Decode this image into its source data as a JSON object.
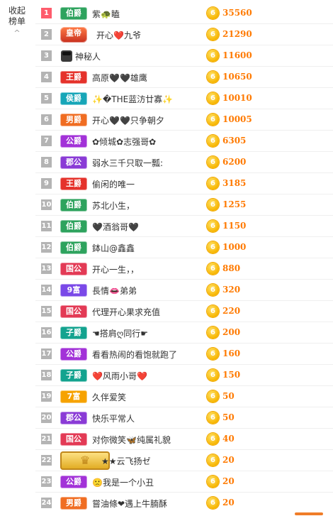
{
  "sidebar": {
    "collapse_label_1": "收起",
    "collapse_label_2": "榜单",
    "chevron": "^"
  },
  "colors": {
    "rank_top": "#fe5c6c",
    "rank_default": "#b4b4b4",
    "score": "#ff7a00",
    "coin": "#f7b500",
    "badges": {
      "伯爵": "#2ea35e",
      "王爵": "#e5322b",
      "侯爵": "#17a6b8",
      "男爵": "#f06d22",
      "公爵": "#a232d8",
      "郡公": "#8a3bd6",
      "国公": "#e33a55",
      "子爵": "#13a38f",
      "9富": "#7a49e8",
      "7富": "#f6a200",
      "皇帝": "#c8301e",
      "crown": "#e0a81c"
    }
  },
  "rows": [
    {
      "rank": "1",
      "badge": "伯爵",
      "name": "紫🐢瞌",
      "score": "35560"
    },
    {
      "rank": "2",
      "badge": "皇帝",
      "name": "开心❤️九爷",
      "score": "21290"
    },
    {
      "rank": "3",
      "badge": "",
      "icon": "mystery-person-icon",
      "name": "神秘人",
      "score": "11600"
    },
    {
      "rank": "4",
      "badge": "王爵",
      "name": "高原🖤🖤雄鹰",
      "score": "10650"
    },
    {
      "rank": "5",
      "badge": "侯爵",
      "name": "✨�THE蓝汸廿寡✨",
      "score": "10010"
    },
    {
      "rank": "6",
      "badge": "男爵",
      "name": "开心🖤🖤只争朝夕",
      "score": "10005"
    },
    {
      "rank": "7",
      "badge": "公爵",
      "name": "✿倾城✿志强哥✿",
      "score": "6305"
    },
    {
      "rank": "8",
      "badge": "郡公",
      "name": "弱水三千只取一瓢:",
      "score": "6200"
    },
    {
      "rank": "9",
      "badge": "王爵",
      "name": "偷闲的唯一",
      "score": "3185"
    },
    {
      "rank": "10",
      "badge": "伯爵",
      "name": "苏北小生，",
      "score": "1255"
    },
    {
      "rank": "11",
      "badge": "伯爵",
      "name": "🖤酒翁哥🖤",
      "score": "1150"
    },
    {
      "rank": "12",
      "badge": "伯爵",
      "name": "鉢山@鑫鑫",
      "score": "1000"
    },
    {
      "rank": "13",
      "badge": "国公",
      "name": "开心一生，，",
      "score": "880"
    },
    {
      "rank": "14",
      "badge": "9富",
      "name": "長情👄弟弟",
      "score": "320"
    },
    {
      "rank": "15",
      "badge": "国公",
      "name": "代理开心果求充值",
      "score": "220"
    },
    {
      "rank": "16",
      "badge": "子爵",
      "name": "☚搭肩ღ同行☛",
      "score": "200"
    },
    {
      "rank": "17",
      "badge": "公爵",
      "name": "看看热闹的看饱就跑了",
      "score": "160"
    },
    {
      "rank": "18",
      "badge": "子爵",
      "name": "❤️风雨小哥❤️",
      "score": "150"
    },
    {
      "rank": "19",
      "badge": "7富",
      "name": "久伴爱笑",
      "score": "50"
    },
    {
      "rank": "20",
      "badge": "郡公",
      "name": "快乐平常人",
      "score": "50"
    },
    {
      "rank": "21",
      "badge": "国公",
      "name": "对你微笑🦋纯属礼貌",
      "score": "40"
    },
    {
      "rank": "22",
      "badge": "crown",
      "name": "★★云飞扬ゼ",
      "score": "20"
    },
    {
      "rank": "23",
      "badge": "公爵",
      "name": "🙁我是一个小丑",
      "score": "20"
    },
    {
      "rank": "24",
      "badge": "男爵",
      "name": "嘗油條❤遇上牛腩酥",
      "score": "20"
    }
  ]
}
